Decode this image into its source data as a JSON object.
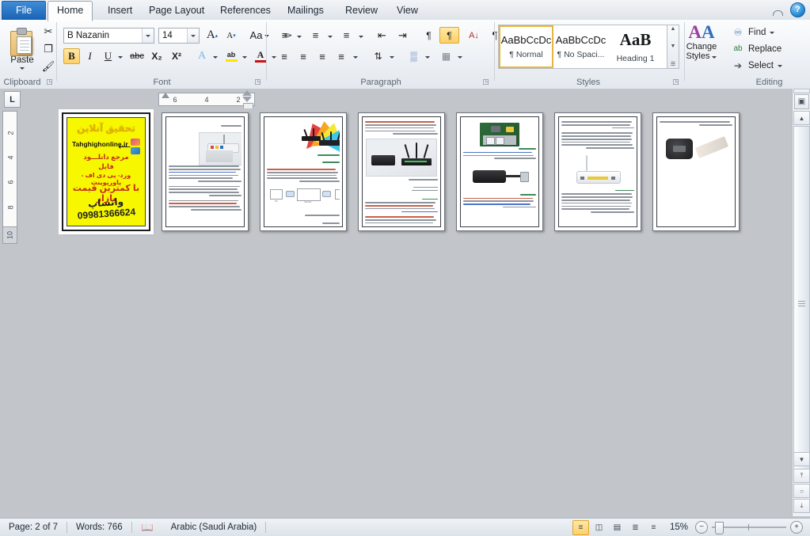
{
  "app": {
    "title": "Microsoft Word 2010",
    "tabs": [
      {
        "id": "file",
        "label": "File"
      },
      {
        "id": "home",
        "label": "Home"
      },
      {
        "id": "insert",
        "label": "Insert"
      },
      {
        "id": "layout",
        "label": "Page Layout"
      },
      {
        "id": "refs",
        "label": "References"
      },
      {
        "id": "mail",
        "label": "Mailings"
      },
      {
        "id": "review",
        "label": "Review"
      },
      {
        "id": "view",
        "label": "View"
      }
    ],
    "active_tab": "Home",
    "window_controls": {
      "minimize_ribbon_icon": "chevron-up-icon",
      "help_icon": "question-mark-icon",
      "help_label": "?"
    }
  },
  "ribbon": {
    "clipboard": {
      "label": "Clipboard",
      "paste_label": "Paste",
      "paste_icon": "clipboard-paste-icon",
      "cut_icon": "scissors-icon",
      "cut_label": "✂",
      "copy_icon": "copy-icon",
      "copy_label": "❐",
      "format_painter_icon": "paintbrush-icon",
      "format_painter_label": "🖌",
      "dialog_launcher": "clipboard-dialog-launcher"
    },
    "font": {
      "label": "Font",
      "font_name": "B Nazanin",
      "font_size": "14",
      "grow_font_label": "A",
      "shrink_font_label": "A",
      "change_case_label": "Aa",
      "clear_formatting_label": "✑",
      "bold_label": "B",
      "italic_label": "I",
      "underline_label": "U",
      "strikethrough_label": "abc",
      "subscript_label": "X₂",
      "superscript_label": "X²",
      "text_effects_label": "A",
      "highlight_label": "ab",
      "font_color_label": "A",
      "bold_active": true,
      "dialog_launcher": "font-dialog-launcher"
    },
    "paragraph": {
      "label": "Paragraph",
      "bullets_label": "≡",
      "numbering_label": "≡",
      "multilevel_label": "≡",
      "decrease_indent_label": "⇤",
      "increase_indent_label": "⇥",
      "ltr_label": "¶",
      "rtl_label": "¶",
      "sort_label": "A↓",
      "show_marks_label": "¶",
      "align_left_label": "≡",
      "align_center_label": "≡",
      "align_right_label": "≡",
      "justify_label": "≡",
      "line_spacing_label": "⇅",
      "shading_label": "▒",
      "borders_label": "▦",
      "rtl_active": true,
      "dialog_launcher": "paragraph-dialog-launcher"
    },
    "styles": {
      "label": "Styles",
      "gallery": [
        {
          "sample": "AaBbCcDc",
          "name": "¶ Normal",
          "selected": true
        },
        {
          "sample": "AaBbCcDc",
          "name": "¶ No Spaci...",
          "selected": false
        },
        {
          "sample": "AaB",
          "name": "Heading 1",
          "selected": false
        }
      ],
      "scroll_up_icon": "scroll-up-icon",
      "scroll_down_icon": "scroll-down-icon",
      "more_icon": "styles-more-icon",
      "change_styles_label": "Change\nStyles",
      "change_styles_line1": "Change",
      "change_styles_line2": "Styles",
      "change_styles_icon": "change-styles-icon",
      "dialog_launcher": "styles-dialog-launcher"
    },
    "editing": {
      "label": "Editing",
      "find_label": "Find",
      "find_icon": "binoculars-icon",
      "replace_label": "Replace",
      "replace_icon": "replace-icon",
      "select_label": "Select",
      "select_icon": "cursor-arrow-icon"
    }
  },
  "ruler": {
    "tab_stop_selector": "L",
    "tab_stop_icon": "left-tab-stop-icon",
    "horizontal_marks": [
      "6",
      "4",
      "2"
    ],
    "vertical_marks": [
      "2",
      "4",
      "6",
      "8",
      "10"
    ],
    "vertical_bottom_mark": "10"
  },
  "document": {
    "view": "multi-page-thumbnails",
    "pages": [
      {
        "index": 1,
        "selected": true,
        "type": "cover",
        "cover": {
          "title": "تحقیق آنلاین",
          "site": "Tahghighonline.ir",
          "line1": "مرجع دانلـــود",
          "line2": "فایل",
          "line3": "ورد- پی دی اف - پاورپوینت",
          "line4": "با کمترین قیمت بازار",
          "phone": "09981366624",
          "whatsapp": "واتساپ",
          "bg_color": "#f7f700",
          "title_color": "#e2b400",
          "text_color": "#c32b1c"
        }
      },
      {
        "index": 2,
        "selected": false,
        "type": "text-with-photo",
        "image": "wifi-router-cables-photo"
      },
      {
        "index": 3,
        "selected": false,
        "type": "text-with-diagram",
        "image": "colorful-fan-routers-photo"
      },
      {
        "index": 4,
        "selected": false,
        "type": "text-with-photo",
        "image": "modem-and-router-photo"
      },
      {
        "index": 5,
        "selected": false,
        "type": "text-with-photo",
        "image": "network-card-and-usb-adapter-photo"
      },
      {
        "index": 6,
        "selected": false,
        "type": "text-with-photo",
        "image": "white-adsl-modem-photo"
      },
      {
        "index": 7,
        "selected": false,
        "type": "text-with-photo",
        "image": "mifi-portable-modem-photo"
      }
    ]
  },
  "status_bar": {
    "page_info": "Page: 2 of 7",
    "word_count": "Words: 766",
    "proofing_icon": "proofing-errors-icon",
    "language": "Arabic (Saudi Arabia)",
    "views": [
      {
        "id": "print-layout",
        "label": "≡",
        "icon": "print-layout-icon",
        "active": true
      },
      {
        "id": "full-screen",
        "label": "◫",
        "icon": "full-screen-reading-icon",
        "active": false
      },
      {
        "id": "web-layout",
        "label": "▤",
        "icon": "web-layout-icon",
        "active": false
      },
      {
        "id": "outline",
        "label": "≣",
        "icon": "outline-view-icon",
        "active": false
      },
      {
        "id": "draft",
        "label": "≡",
        "icon": "draft-view-icon",
        "active": false
      }
    ],
    "zoom_level": "15%",
    "zoom_out_label": "−",
    "zoom_in_label": "+",
    "zoom_out_icon": "zoom-out-icon",
    "zoom_in_icon": "zoom-in-icon"
  },
  "scrollbar": {
    "split_handle_icon": "split-window-icon",
    "object_browse_icon": "select-browse-object-icon",
    "up_arrow": "▲",
    "down_arrow": "▼",
    "prev_page": "⤒",
    "next_page": "⤓",
    "browse_circle": "○"
  }
}
